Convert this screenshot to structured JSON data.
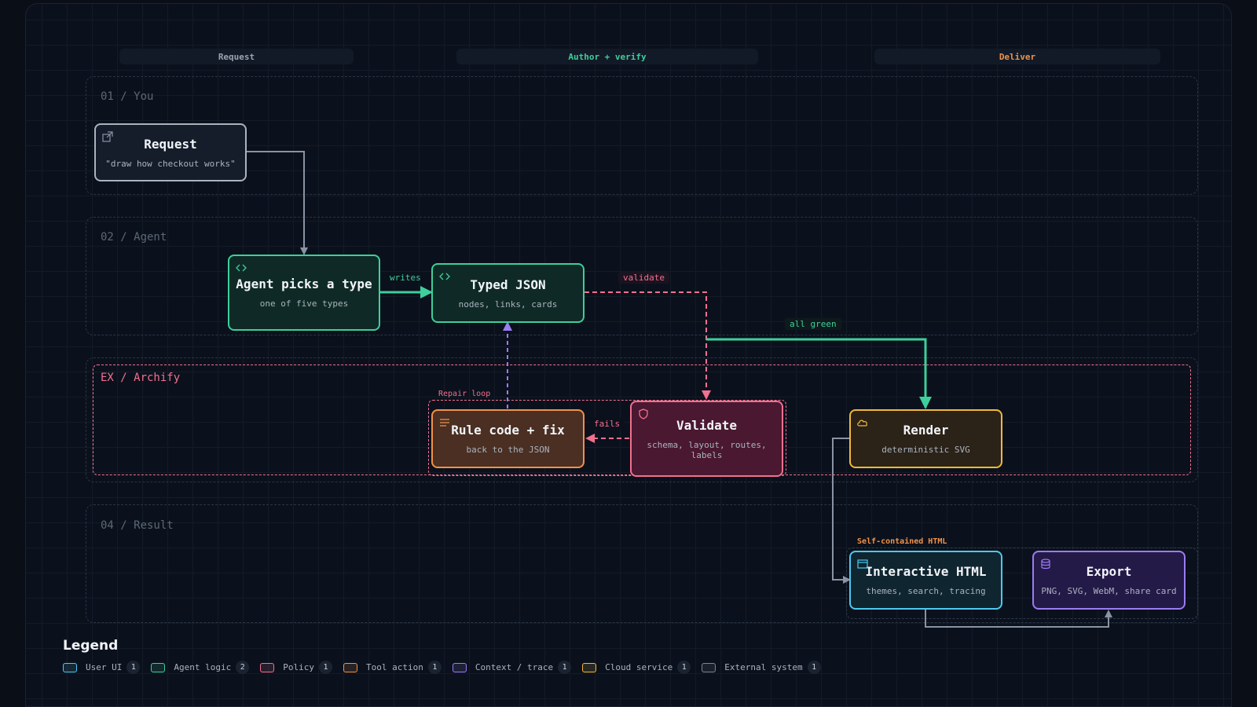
{
  "columns": [
    "Request",
    "Author + verify",
    "Deliver"
  ],
  "lanes": {
    "you": "01 / You",
    "agent": "02 / Agent",
    "archify": "EX / Archify",
    "result": "04 / Result"
  },
  "groups": {
    "repair_loop": "Repair loop",
    "self_contained": "Self-contained HTML"
  },
  "nodes": {
    "request": {
      "title": "Request",
      "sub": "\"draw how checkout works\"",
      "icon": "external-link-icon"
    },
    "agent": {
      "title": "Agent picks a type",
      "sub": "one of five types",
      "icon": "code-icon"
    },
    "json": {
      "title": "Typed JSON",
      "sub": "nodes, links, cards",
      "icon": "code-icon"
    },
    "rule": {
      "title": "Rule code + fix",
      "sub": "back to the JSON",
      "icon": "list-icon"
    },
    "validate": {
      "title": "Validate",
      "sub": "schema, layout, routes, labels",
      "icon": "shield-icon"
    },
    "render": {
      "title": "Render",
      "sub": "deterministic SVG",
      "icon": "cloud-icon"
    },
    "html": {
      "title": "Interactive HTML",
      "sub": "themes, search, tracing",
      "icon": "window-icon"
    },
    "export": {
      "title": "Export",
      "sub": "PNG, SVG, WebM, share card",
      "icon": "database-icon"
    }
  },
  "edge_labels": {
    "writes": "writes",
    "validate": "validate",
    "all_green": "all green",
    "fails": "fails"
  },
  "legend": {
    "title": "Legend",
    "items": [
      {
        "label": "User UI",
        "count": "1",
        "color": "#4cc9f0"
      },
      {
        "label": "Agent logic",
        "count": "2",
        "color": "#3ecf9a"
      },
      {
        "label": "Policy",
        "count": "1",
        "color": "#f2708f"
      },
      {
        "label": "Tool action",
        "count": "1",
        "color": "#f0924a"
      },
      {
        "label": "Context / trace",
        "count": "1",
        "color": "#9b7cf4"
      },
      {
        "label": "Cloud service",
        "count": "1",
        "color": "#f0b93a"
      },
      {
        "label": "External system",
        "count": "1",
        "color": "#7c8696"
      }
    ]
  },
  "colors": {
    "user_ui": "#4cc9f0",
    "agent_logic": "#3ecf9a",
    "policy": "#f2708f",
    "tool_action": "#f0924a",
    "context": "#9b7cf4",
    "cloud": "#f0b93a",
    "external": "#7c8696"
  }
}
